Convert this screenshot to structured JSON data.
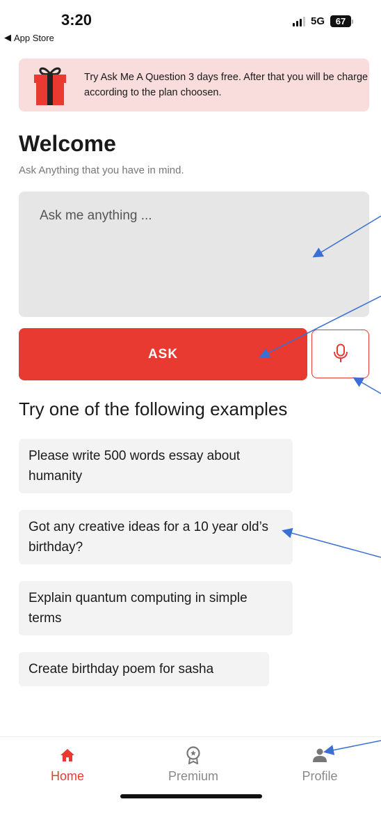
{
  "status_bar": {
    "time": "3:20",
    "back_label": "App Store",
    "network": "5G",
    "battery": "67"
  },
  "promo": {
    "text": "Try Ask Me A Question 3 days free. After that you will be charge according to the plan choosen.",
    "icon": "gift-icon"
  },
  "welcome": {
    "title": "Welcome",
    "subtitle": "Ask Anything that you have in mind."
  },
  "ask_input": {
    "placeholder": "Ask me anything ...",
    "value": ""
  },
  "ask_button": {
    "label": "ASK"
  },
  "mic_button": {
    "icon": "microphone-icon"
  },
  "examples": {
    "heading": "Try one of the following examples",
    "items": [
      "Please write 500 words essay about humanity",
      "Got any creative ideas for a 10 year old’s birthday?",
      "Explain quantum computing in simple terms",
      "Create birthday poem for sasha"
    ]
  },
  "tabs": [
    {
      "label": "Home",
      "icon": "home-icon",
      "active": true
    },
    {
      "label": "Premium",
      "icon": "award-icon",
      "active": false
    },
    {
      "label": "Profile",
      "icon": "user-icon",
      "active": false
    }
  ],
  "colors": {
    "accent": "#e83a30",
    "promo_bg": "#f9dcdc",
    "input_bg": "#e6e6e6",
    "example_bg": "#f3f3f3",
    "annotation_arrow": "#3b6fd4"
  }
}
